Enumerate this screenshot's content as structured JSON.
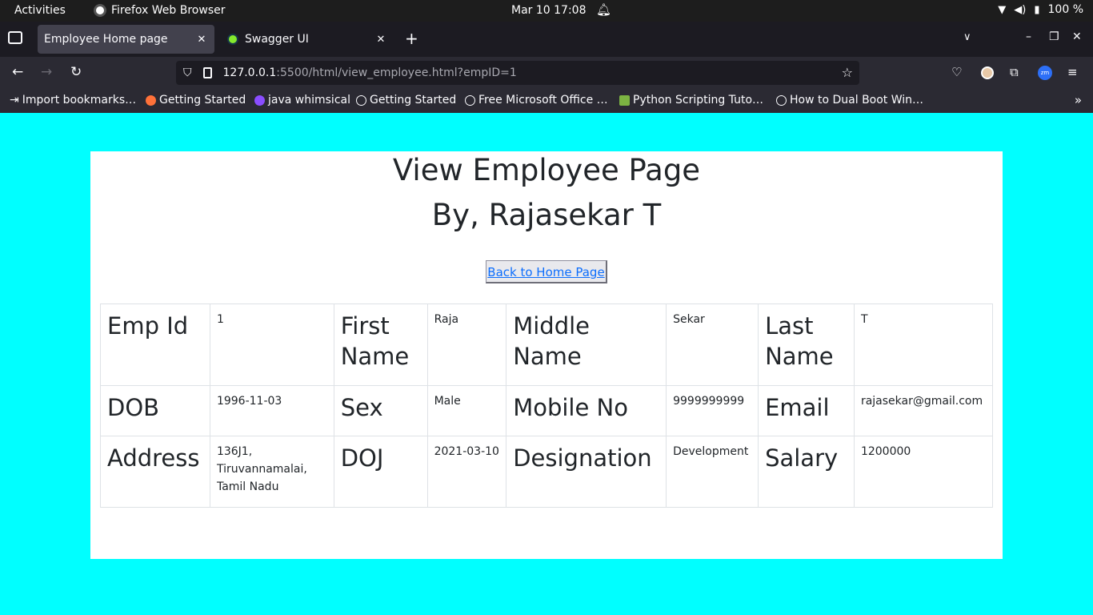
{
  "system_bar": {
    "activities": "Activities",
    "app_name": "Firefox Web Browser",
    "clock": "Mar 10  17:08",
    "battery": "100 %"
  },
  "tabs": [
    {
      "label": "Employee Home page",
      "active": true
    },
    {
      "label": "Swagger UI",
      "active": false
    }
  ],
  "address": {
    "host": "127.0.0.1",
    "rest": ":5500/html/view_employee.html?empID=1"
  },
  "bookmarks": [
    {
      "label": "Import bookmarks…",
      "icon": "import-icon"
    },
    {
      "label": "Getting Started",
      "icon": "firefox-icon"
    },
    {
      "label": "java whimsical",
      "icon": "whimsical-icon"
    },
    {
      "label": "Getting Started",
      "icon": "globe-icon"
    },
    {
      "label": "Free Microsoft Office …",
      "icon": "globe-icon"
    },
    {
      "label": "Python Scripting Tuto…",
      "icon": "python-icon"
    },
    {
      "label": "How to Dual Boot Win…",
      "icon": "globe-icon"
    }
  ],
  "page": {
    "title_line1": "View Employee Page",
    "title_line2": "By, Rajasekar T",
    "back_link": "Back to Home Page",
    "background_color": "#00ffff",
    "rows": [
      [
        {
          "key": "Emp Id",
          "value": "1"
        },
        {
          "key": "First Name",
          "value": "Raja"
        },
        {
          "key": "Middle Name",
          "value": "Sekar"
        },
        {
          "key": "Last Name",
          "value": "T"
        }
      ],
      [
        {
          "key": "DOB",
          "value": "1996-11-03"
        },
        {
          "key": "Sex",
          "value": "Male"
        },
        {
          "key": "Mobile No",
          "value": "9999999999"
        },
        {
          "key": "Email",
          "value": "rajasekar@gmail.com"
        }
      ],
      [
        {
          "key": "Address",
          "value": "136J1, Tiruvannamalai, Tamil Nadu"
        },
        {
          "key": "DOJ",
          "value": "2021-03-10"
        },
        {
          "key": "Designation",
          "value": "Development"
        },
        {
          "key": "Salary",
          "value": "1200000"
        }
      ]
    ]
  }
}
